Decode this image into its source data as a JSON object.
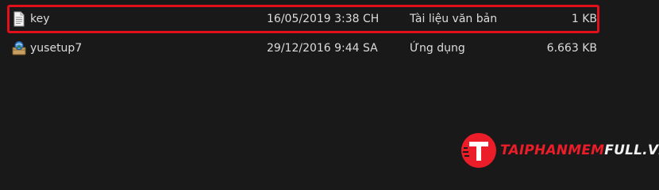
{
  "files": [
    {
      "name": "key",
      "modified": "16/05/2019 3:38 CH",
      "type": "Tài liệu văn bản",
      "size": "1 KB",
      "icon": "text-document-icon",
      "highlighted": true
    },
    {
      "name": "yusetup7",
      "modified": "29/12/2016 9:44 SA",
      "type": "Ứng dụng",
      "size": "6.663 KB",
      "icon": "installer-app-icon",
      "highlighted": false
    }
  ],
  "highlight_color": "#e2101a",
  "watermark": {
    "logo_letter": "T",
    "text_red": "TAIPHANMEM",
    "text_white": "FULL.VN",
    "brand_color": "#ea1d28"
  }
}
